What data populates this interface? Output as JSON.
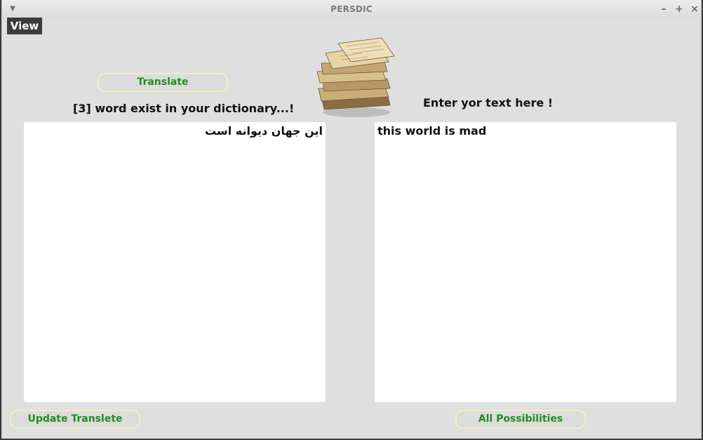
{
  "window": {
    "title": "PERSDIC"
  },
  "menubar": {
    "view_label": "View"
  },
  "translate_button": {
    "label": "Translate"
  },
  "status": {
    "text": "[3] word exist in your dictionary...!"
  },
  "prompt": {
    "text": "Enter yor text here !"
  },
  "output": {
    "text": "این جهان دیوانه است"
  },
  "input": {
    "text": "this world is mad"
  },
  "update_button": {
    "label": "Update Translete"
  },
  "all_button": {
    "label": "All Possibilities"
  },
  "colors": {
    "button_text": "#1f8f1f",
    "button_border": "#efefc6"
  }
}
